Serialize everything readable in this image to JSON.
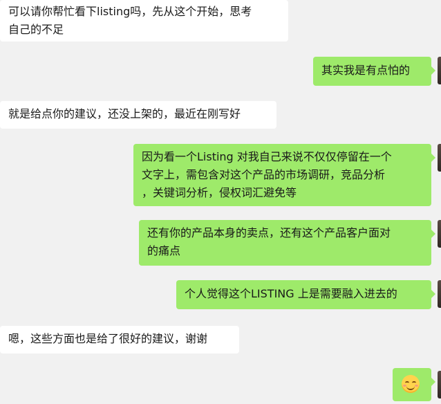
{
  "messages": [
    {
      "side": "in",
      "text": "可以请你帮忙看下listing吗，先从这个开始，思考\n自己的不足"
    },
    {
      "side": "out",
      "text": "其实我是有点怕的"
    },
    {
      "side": "in",
      "text": "就是给点你的建议，还没上架的，最近在刚写好"
    },
    {
      "side": "out",
      "text": "因为看一个Listing 对我自己来说不仅仅停留在一个\n文字上，需包含对这个产品的市场调研，竞品分析\n，关键词分析，侵权词汇避免等"
    },
    {
      "side": "out",
      "text": "还有你的产品本身的卖点，还有这个产品客户面对\n的痛点"
    },
    {
      "side": "out",
      "text": "个人觉得这个LISTING 上是需要融入进去的"
    },
    {
      "side": "in",
      "text": "嗯，这些方面也是给了很好的建议，谢谢"
    },
    {
      "side": "out",
      "emoji": "smiling-face-emoji"
    }
  ],
  "colors": {
    "background": "#f1f1f1",
    "incoming_bubble": "#ffffff",
    "outgoing_bubble": "#9eea6a"
  }
}
